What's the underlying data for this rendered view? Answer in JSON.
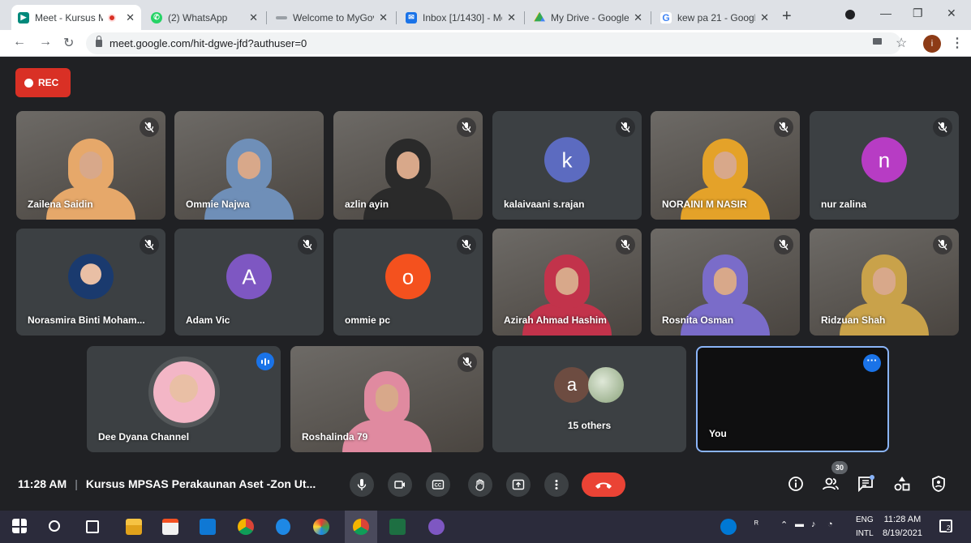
{
  "browser": {
    "tabs": [
      {
        "title": "Meet - Kursus M",
        "active": true,
        "icon": "meet-icon",
        "color": "#00897b"
      },
      {
        "title": "(2) WhatsApp",
        "icon": "whatsapp-icon",
        "color": "#25d366"
      },
      {
        "title": "Welcome to MyGov",
        "icon": "mygov-icon",
        "color": "#9aa0a6"
      },
      {
        "title": "Inbox [1/1430] - Mo",
        "icon": "mail-icon",
        "color": "#1a73e8"
      },
      {
        "title": "My Drive - Google D",
        "icon": "drive-icon",
        "color": "#fbbc04"
      },
      {
        "title": "kew pa 21 - Google",
        "icon": "google-icon",
        "color": "#4285f4"
      }
    ],
    "url": "meet.google.com/hit-dgwe-jfd?authuser=0",
    "profile_initial": "i"
  },
  "recording": {
    "label": "REC"
  },
  "participants": [
    {
      "name": "Zailena Saidin",
      "type": "video",
      "muted": true,
      "tone": "#e6a86a"
    },
    {
      "name": "Ommie Najwa",
      "type": "video",
      "muted": false,
      "tone": "#6f8fb8"
    },
    {
      "name": "azlin ayin",
      "type": "video",
      "muted": true,
      "tone": "#2a2a2a"
    },
    {
      "name": "kalaivaani s.rajan",
      "type": "avatar",
      "initial": "k",
      "color": "#5c6bc0",
      "muted": true
    },
    {
      "name": "NORAINI M NASIR",
      "type": "video",
      "muted": true,
      "tone": "#e4a229"
    },
    {
      "name": "nur zalina",
      "type": "avatar",
      "initial": "n",
      "color": "#b73cc4",
      "muted": true
    },
    {
      "name": "Norasmira Binti Moham...",
      "type": "photo-avatar",
      "muted": true,
      "tone": "#1a3a6e"
    },
    {
      "name": "Adam Vic",
      "type": "avatar",
      "initial": "A",
      "color": "#7e57c2",
      "muted": true
    },
    {
      "name": "ommie pc",
      "type": "avatar",
      "initial": "o",
      "color": "#f4511e",
      "muted": true
    },
    {
      "name": "Azirah Ahmad Hashim",
      "type": "video",
      "muted": true,
      "tone": "#c2334b"
    },
    {
      "name": "Rosnita Osman",
      "type": "video",
      "muted": true,
      "tone": "#7a6cc9"
    },
    {
      "name": "Ridzuan Shah",
      "type": "video",
      "muted": true,
      "tone": "#c9a24a"
    },
    {
      "name": "Dee Dyana Channel",
      "type": "photo-avatar",
      "speaking": true,
      "tone": "#f3b6c6"
    },
    {
      "name": "Roshalinda 79",
      "type": "video",
      "muted": true,
      "tone": "#e08aa0"
    },
    {
      "name": "15 others",
      "type": "others",
      "initial": "a",
      "color": "#6d4c41"
    },
    {
      "name": "You",
      "type": "self"
    }
  ],
  "bottom_bar": {
    "time": "11:28 AM",
    "meeting_title": "Kursus MPSAS Perakaunan Aset -Zon Ut...",
    "participant_count": "30"
  },
  "taskbar": {
    "lang_top": "ENG",
    "lang_bottom": "INTL",
    "time": "11:28 AM",
    "date": "8/19/2021",
    "notifications": "2"
  }
}
